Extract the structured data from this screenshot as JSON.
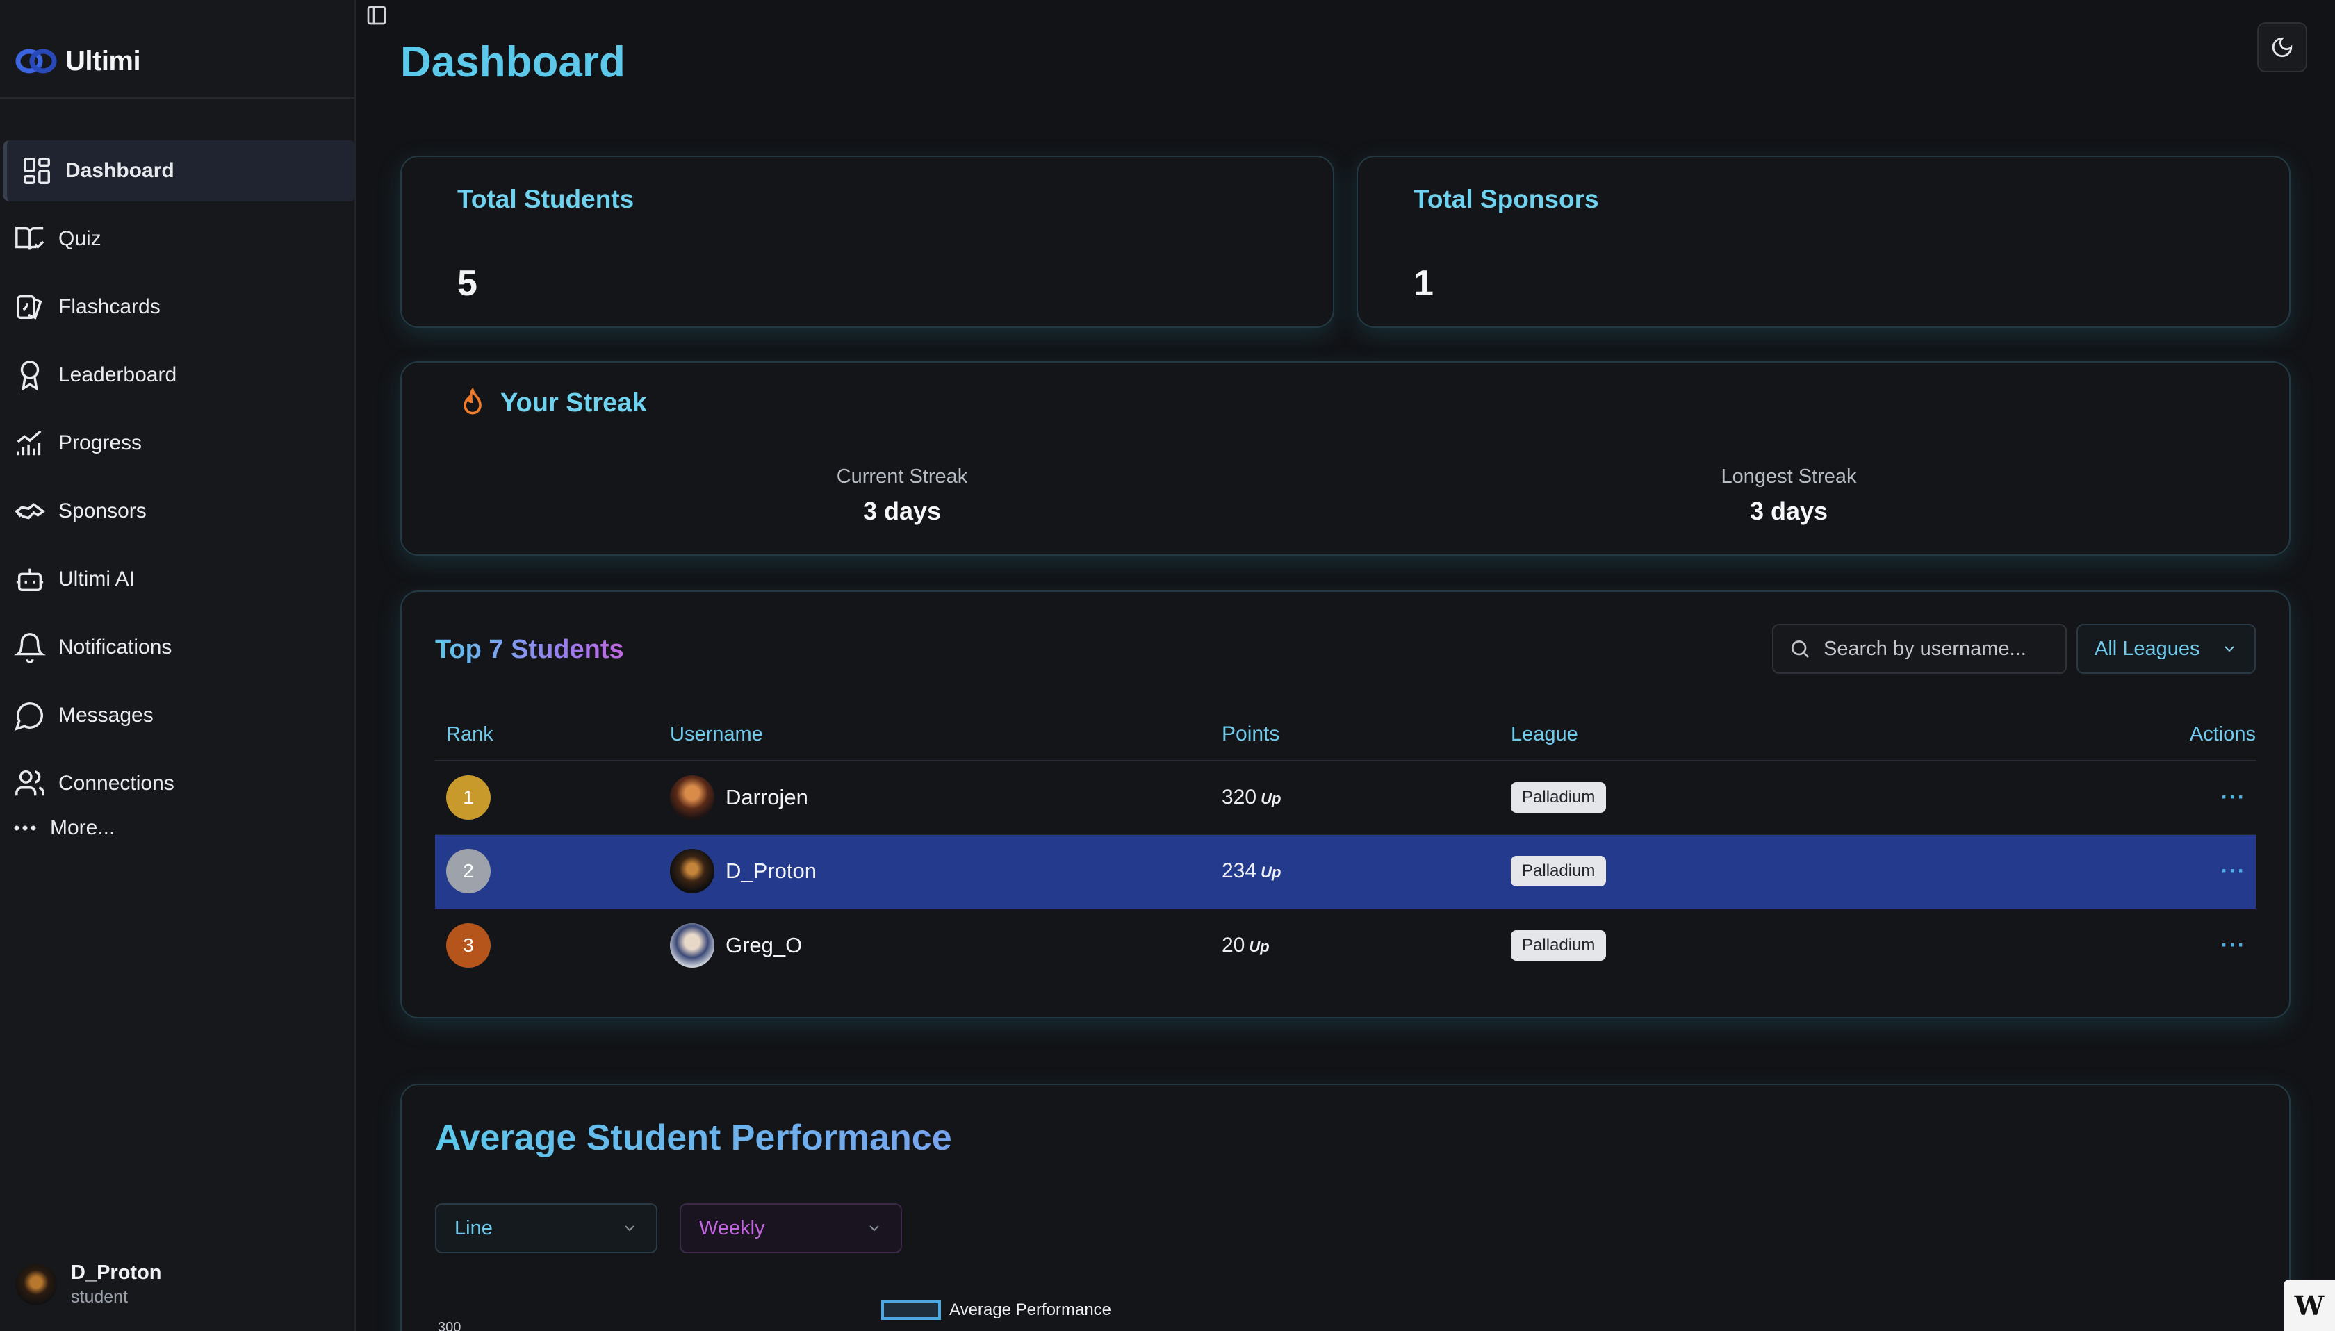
{
  "app": {
    "name": "Ultimi"
  },
  "sidebar": {
    "items": [
      {
        "label": "Dashboard",
        "icon": "dashboard-icon"
      },
      {
        "label": "Quiz",
        "icon": "quiz-book-icon"
      },
      {
        "label": "Flashcards",
        "icon": "flashcards-icon"
      },
      {
        "label": "Leaderboard",
        "icon": "award-icon"
      },
      {
        "label": "Progress",
        "icon": "chart-icon"
      },
      {
        "label": "Sponsors",
        "icon": "handshake-icon"
      },
      {
        "label": "Ultimi AI",
        "icon": "bot-icon"
      },
      {
        "label": "Notifications",
        "icon": "bell-icon"
      },
      {
        "label": "Messages",
        "icon": "message-icon"
      },
      {
        "label": "Connections",
        "icon": "users-icon"
      }
    ],
    "more_label": "More...",
    "user": {
      "name": "D_Proton",
      "role": "student"
    }
  },
  "header": {
    "title": "Dashboard"
  },
  "stats": {
    "students": {
      "title": "Total Students",
      "value": "5"
    },
    "sponsors": {
      "title": "Total Sponsors",
      "value": "1"
    }
  },
  "streak": {
    "title": "Your Streak",
    "current_label": "Current Streak",
    "current_value": "3 days",
    "longest_label": "Longest Streak",
    "longest_value": "3 days"
  },
  "top_students": {
    "title": "Top 7 Students",
    "search_placeholder": "Search by username...",
    "league_filter": "All Leagues",
    "columns": [
      "Rank",
      "Username",
      "Points",
      "League",
      "Actions"
    ],
    "rows": [
      {
        "rank": "1",
        "username": "Darrojen",
        "points": "320",
        "unit": "Up",
        "league": "Palladium",
        "actions": "···",
        "rank_color": "#c89a2c"
      },
      {
        "rank": "2",
        "username": "D_Proton",
        "points": "234",
        "unit": "Up",
        "league": "Palladium",
        "actions": "···",
        "rank_color": "#9da2ab"
      },
      {
        "rank": "3",
        "username": "Greg_O",
        "points": "20",
        "unit": "Up",
        "league": "Palladium",
        "actions": "···",
        "rank_color": "#b5551b"
      }
    ]
  },
  "performance": {
    "title": "Average Student Performance",
    "chart_type_select": "Line",
    "period_select": "Weekly",
    "legend_label": "Average Performance",
    "y_peek": "300"
  },
  "colors": {
    "accent": "#5cc8ea",
    "selected_row": "#243a8c",
    "purple": "#c266e0"
  }
}
